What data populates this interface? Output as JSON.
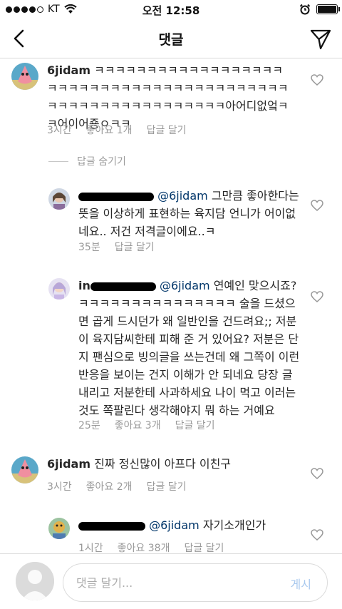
{
  "status_bar": {
    "carrier": "KT",
    "time": "오전 12:58"
  },
  "header": {
    "title": "댓글"
  },
  "hide_replies_label": "답글 숨기기",
  "comments": [
    {
      "username": "6jidam",
      "text": "ㅋㅋㅋㅋㅋㅋㅋㅋㅋㅋㅋㅋㅋㅋㅋㅋㅋㅋㅋㅋㅋㅋㅋㅋㅋㅋㅋㅋㅋㅋㅋㅋㅋㅋㅋㅋㅋㅋㅋㅋㅋㅋㅋㅋㅋㅋㅋㅋㅋㅋㅋㅋㅋㅋㅋㅋㅋㅋ아어디없엌ㅋㅋ어이어죵ㅇㅋㅋ",
      "time": "3시간",
      "likes": "좋아요 1개",
      "reply": "답글 달기"
    },
    {
      "mention": "@6jidam",
      "text": "그만큼 좋아한다는 뜻을 이상하게 표현하는 육지담 언니가 어이없네요.. 저건 저격글이에요..ㅋ",
      "time": "35분",
      "reply": "답글 달기"
    },
    {
      "username_prefix": "in",
      "mention": "@6jidam",
      "text": "연예인 맞으시죠? ㅋㅋㅋㅋㅋㅋㅋㅋㅋㅋㅋㅋㅋㅋㅋ 술을 드셨으면 곱게 드시던가 왜 일반인을 건드려요;; 저분이 육지담씨한테 피해 준 거 있어요? 저분은 단지 팬심으로 빙의글을 쓰는건데 왜 그쪽이 이런 반응을 보이는 건지 이해가 안 되네요 당장 글 내리고 저분한테 사과하세요 나이 먹고 이러는 것도 쪽팔린다 생각해야지 뭐 하는 거예요",
      "time": "25분",
      "likes": "좋아요 3개",
      "reply": "답글 달기"
    },
    {
      "username": "6jidam",
      "text": "진짜 정신많이 아프다 이친구",
      "time": "3시간",
      "likes": "좋아요 2개",
      "reply": "답글 달기"
    },
    {
      "mention": "@6jidam",
      "text": "자기소개인가",
      "time": "1시간",
      "likes": "좋아요 38개",
      "reply": "답글 달기"
    }
  ],
  "input": {
    "placeholder": "댓글 달기...",
    "post_label": "게시"
  },
  "colors": {
    "mention": "#003569",
    "meta": "#999999",
    "post": "#a8c8ee",
    "divider": "#dbdbdb"
  }
}
